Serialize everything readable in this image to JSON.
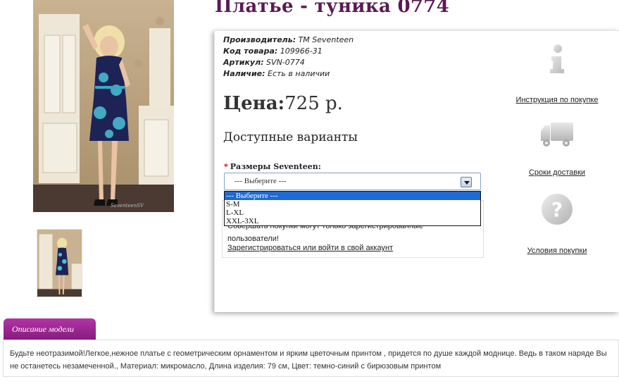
{
  "product": {
    "title": "Платье - туника 0774",
    "specs": [
      {
        "label": "Производитель:",
        "value": " ТМ Seventeen"
      },
      {
        "label": "Код товара:",
        "value": " 109966-31"
      },
      {
        "label": "Артикул:",
        "value": " SVN-0774"
      },
      {
        "label": "Наличие:",
        "value": " Есть в наличии"
      }
    ],
    "price_label": "Цена:",
    "price_value": "725 р.",
    "variants_heading": "Доступные варианты",
    "size_label": "Размеры Seventeen:",
    "size_required_mark": "*",
    "size_selected": "--- Выберите ---",
    "size_options": [
      "--- Выберите ---",
      "S-M",
      "L-XL",
      "XXL-3XL"
    ],
    "login_note_text": "Совершать покупки могут только зарегистрированные пользователи!",
    "login_link": "Зарегистрироваться или войти в свой аккаунт",
    "photo_watermark": "SeventeenSV"
  },
  "sidebar": {
    "instructions": "Инструкция по покупке",
    "delivery": "Сроки доставки",
    "terms": "Условия покупки"
  },
  "description": {
    "tab_label": "Описание модели",
    "text": "Будьте неотразимой!Легкое,нежное платье с геометрическим орнаментом и ярким цветочным принтом , придется по душе каждой моднице. Ведь в таком наряде Вы не останетесь незамеченной., Материал: микромасло, Длина изделия: 79 см, Цвет: темно-синий с бирюзовым принтом"
  },
  "colors": {
    "title": "#5a1a52",
    "tab": "#9b2592",
    "select_highlight": "#1e69d4"
  }
}
